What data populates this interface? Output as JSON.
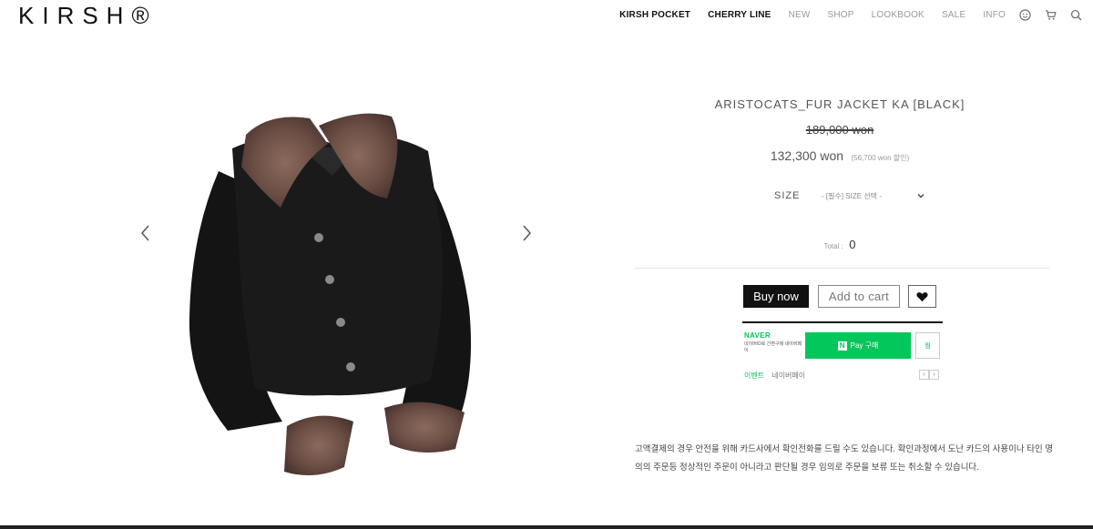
{
  "header": {
    "logo": "KIRSH®",
    "nav": [
      {
        "label": "KIRSH POCKET",
        "bold": true
      },
      {
        "label": "CHERRY LINE",
        "bold": true
      },
      {
        "label": "NEW",
        "bold": false
      },
      {
        "label": "SHOP",
        "bold": false
      },
      {
        "label": "LOOKBOOK",
        "bold": false
      },
      {
        "label": "SALE",
        "bold": false
      },
      {
        "label": "INFO",
        "bold": false
      }
    ],
    "icons": [
      "user-icon",
      "cart-icon",
      "search-icon"
    ]
  },
  "gallery": {
    "prev_icon": "chevron-left-icon",
    "next_icon": "chevron-right-icon",
    "image": "fur-collar-jacket-black"
  },
  "product": {
    "title": "ARISTOCATS_FUR JACKET KA [BLACK]",
    "original_price": "189,000 won",
    "sale_price": "132,300 won",
    "discount": "(56,700 won 할인)",
    "size_label": "SIZE",
    "size_select": "- [필수] SIZE 선택 -",
    "total_label": "Total :",
    "total_value": "0"
  },
  "actions": {
    "buy": "Buy now",
    "cart": "Add to cart",
    "wish_icon": "heart-icon"
  },
  "naver": {
    "brand": "NAVER",
    "sub": "네이버ID로 간편구매 네이버페이",
    "pay_label": "Pay 구매",
    "pay_mark": "N",
    "wish": "찜",
    "event_label": "이벤트",
    "event_text": "네이버페이",
    "prev": "‹",
    "next": "›"
  },
  "notice": "고액결제의 경우 안전을 위해 카드사에서 확인전화를 드릴 수도 있습니다. 확인과정에서 도난 카드의 사용이나 타인 명의의 주문등 정상적인 주문이 아니라고 판단될 경우 임의로 주문을 보류 또는 취소할 수 있습니다.",
  "colors": {
    "accent": "#03c75a",
    "buy_bg": "#111111"
  }
}
